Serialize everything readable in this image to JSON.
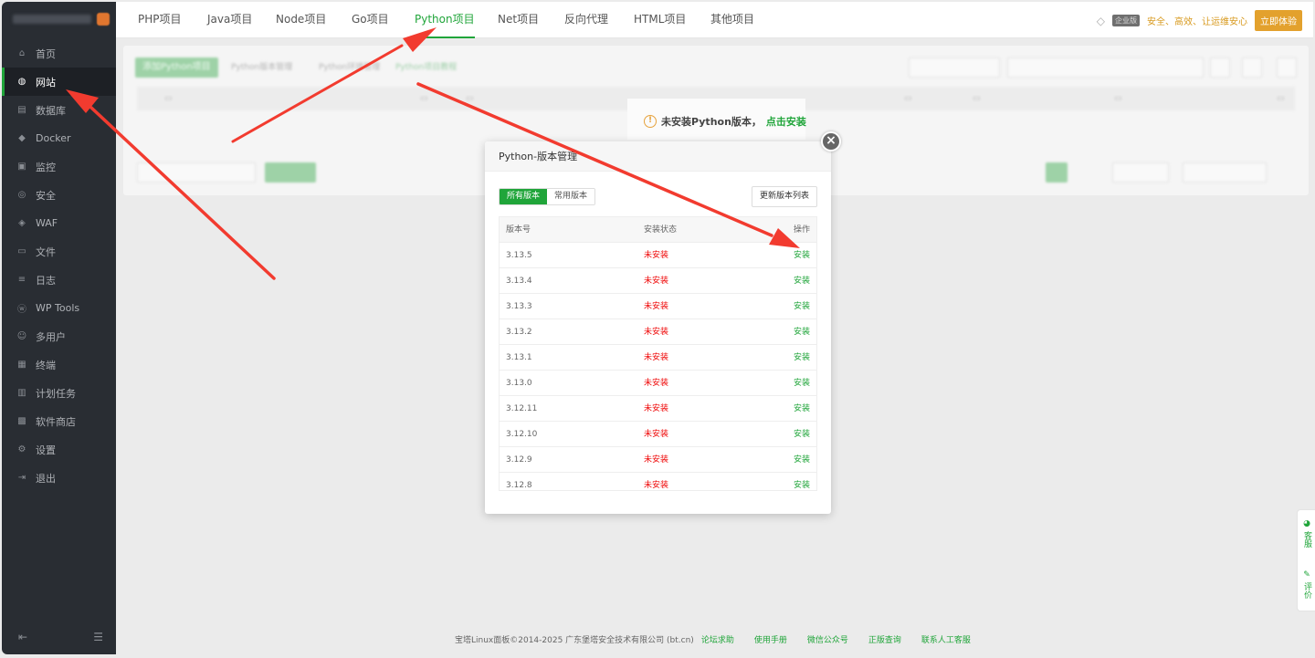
{
  "sidebar": {
    "items": [
      {
        "label": "首页",
        "icon": "home-icon",
        "glyph": "⌂"
      },
      {
        "label": "网站",
        "icon": "globe-icon",
        "glyph": "◍",
        "active": true
      },
      {
        "label": "数据库",
        "icon": "database-icon",
        "glyph": "▤"
      },
      {
        "label": "Docker",
        "icon": "docker-icon",
        "glyph": "◆"
      },
      {
        "label": "监控",
        "icon": "monitor-icon",
        "glyph": "▣"
      },
      {
        "label": "安全",
        "icon": "shield-icon",
        "glyph": "◎"
      },
      {
        "label": "WAF",
        "icon": "waf-shield-icon",
        "glyph": "◈"
      },
      {
        "label": "文件",
        "icon": "folder-icon",
        "glyph": "▭"
      },
      {
        "label": "日志",
        "icon": "log-icon",
        "glyph": "≡"
      },
      {
        "label": "WP Tools",
        "icon": "wordpress-icon",
        "glyph": "ⓦ"
      },
      {
        "label": "多用户",
        "icon": "users-icon",
        "glyph": "☺"
      },
      {
        "label": "终端",
        "icon": "terminal-icon",
        "glyph": "▦"
      },
      {
        "label": "计划任务",
        "icon": "calendar-icon",
        "glyph": "▥"
      },
      {
        "label": "软件商店",
        "icon": "store-icon",
        "glyph": "▩"
      },
      {
        "label": "设置",
        "icon": "gear-icon",
        "glyph": "⚙"
      },
      {
        "label": "退出",
        "icon": "logout-icon",
        "glyph": "⇥"
      }
    ]
  },
  "tabs": [
    "PHP项目",
    "Java项目",
    "Node项目",
    "Go项目",
    "Python项目",
    "Net项目",
    "反向代理",
    "HTML项目",
    "其他项目"
  ],
  "active_tab": "Python项目",
  "header": {
    "vip_tag": "企业版",
    "slogan": "安全、高效、让运维安心",
    "experience_button": "立即体验"
  },
  "content": {
    "add_button": "添加Python项目",
    "version_manage": "Python版本管理",
    "env_manage": "Python环境管理",
    "enterprise_link": "Python项目教程",
    "empty_notice": "未安装Python版本，",
    "empty_link": "点击安装"
  },
  "modal": {
    "title": "Python-版本管理",
    "segment_all": "所有版本",
    "segment_common": "常用版本",
    "refresh_button": "更新版本列表",
    "columns": {
      "version": "版本号",
      "status": "安装状态",
      "action": "操作"
    },
    "rows": [
      {
        "version": "3.13.5",
        "status": "未安装",
        "action": "安装"
      },
      {
        "version": "3.13.4",
        "status": "未安装",
        "action": "安装"
      },
      {
        "version": "3.13.3",
        "status": "未安装",
        "action": "安装"
      },
      {
        "version": "3.13.2",
        "status": "未安装",
        "action": "安装"
      },
      {
        "version": "3.13.1",
        "status": "未安装",
        "action": "安装"
      },
      {
        "version": "3.13.0",
        "status": "未安装",
        "action": "安装"
      },
      {
        "version": "3.12.11",
        "status": "未安装",
        "action": "安装"
      },
      {
        "version": "3.12.10",
        "status": "未安装",
        "action": "安装"
      },
      {
        "version": "3.12.9",
        "status": "未安装",
        "action": "安装"
      },
      {
        "version": "3.12.8",
        "status": "未安装",
        "action": "安装"
      }
    ]
  },
  "footer": {
    "copyright": "宝塔Linux面板©2014-2025 广东堡塔安全技术有限公司 (bt.cn)",
    "links": [
      "论坛求助",
      "使用手册",
      "微信公众号",
      "正版查询",
      "联系人工客服"
    ]
  },
  "float": {
    "service": "客服",
    "feedback": "评价"
  },
  "colors": {
    "brand_green": "#20a53a",
    "status_red": "#ef0808",
    "sidebar_bg": "#292d33",
    "arrow_red": "#f23b2f"
  }
}
